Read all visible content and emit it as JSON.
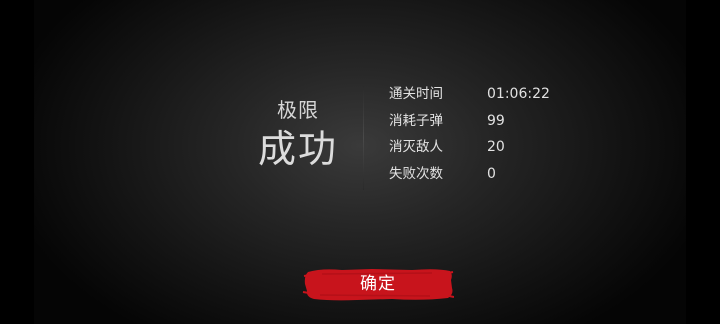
{
  "result_panel": {
    "difficulty": "极限",
    "outcome": "成功"
  },
  "stats": [
    {
      "label": "通关时间",
      "value": "01:06:22"
    },
    {
      "label": "消耗子弹",
      "value": "99"
    },
    {
      "label": "消灭敌人",
      "value": "20"
    },
    {
      "label": "失败次数",
      "value": "0"
    }
  ],
  "confirm_button": {
    "label": "确定",
    "color": "#c8141c"
  }
}
